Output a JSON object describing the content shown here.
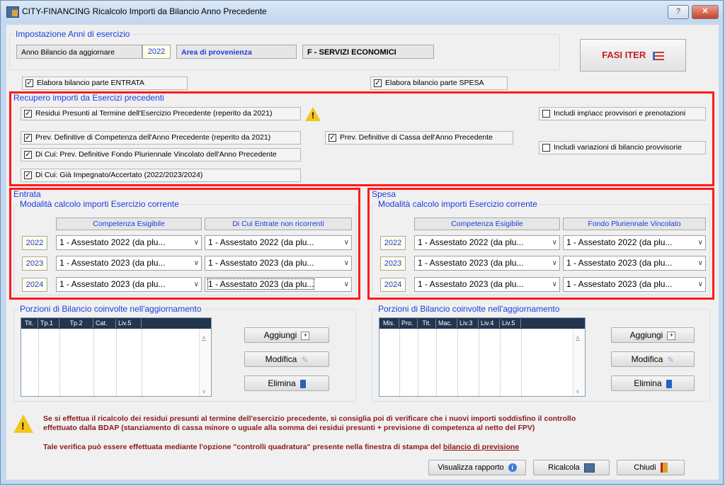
{
  "window": {
    "title": "CITY-FINANCING  Ricalcolo Importi da Bilancio Anno Precedente",
    "help_label": "?",
    "close_label": "✕"
  },
  "anni": {
    "legend": "Impostazione Anni di esercizio",
    "anno_label": "Anno Bilancio da aggiornare",
    "anno_value": "2022",
    "area_label": "Area di provenienza",
    "area_value": "F - SERVIZI ECONOMICI"
  },
  "fasi_iter_label": "FASI ITER",
  "elabora": {
    "entrata": "Elabora bilancio parte ENTRATA",
    "spesa": "Elabora bilancio parte SPESA"
  },
  "recupero": {
    "legend": "Recupero importi da Esercizi precedenti",
    "residui": "Residui Presunti al Termine dell'Esercizio Precedente (reperito da 2021)",
    "prev_comp": "Prev. Definitive di Competenza dell'Anno Precedente (reperito da 2021)",
    "prev_cassa": "Prev. Definitive di Cassa dell'Anno Precedente",
    "fondo": "Di Cui: Prev. Definitive Fondo Pluriennale Vincolato dell'Anno Precedente",
    "impegnato": "Di Cui: Già Impegnato/Accertato (2022/2023/2024)",
    "includi_imp": "Includi imp\\acc provvisori e prenotazioni",
    "includi_var": "Includi variazioni di bilancio provvisorie"
  },
  "entrata": {
    "legend": "Entrata",
    "sublegend": "Modalità calcolo importi Esercizio corrente",
    "col1": "Competenza Esigibile",
    "col2": "Di Cui Entrate non ricorrenti",
    "rows": [
      {
        "year": "2022",
        "c1": "1 - Assestato  2022 (da plu...",
        "c2": "1 - Assestato  2022 (da plu..."
      },
      {
        "year": "2023",
        "c1": "1 - Assestato  2023 (da plu...",
        "c2": "1 - Assestato  2023 (da plu..."
      },
      {
        "year": "2024",
        "c1": "1 - Assestato  2023 (da plu...",
        "c2": "1 - Assestato  2023 (da plu..."
      }
    ]
  },
  "spesa": {
    "legend": "Spesa",
    "sublegend": "Modalità calcolo importi Esercizio corrente",
    "col1": "Competenza Esigibile",
    "col2": "Fondo Pluriennale Vincolato",
    "rows": [
      {
        "year": "2022",
        "c1": "1 - Assestato  2022 (da plu...",
        "c2": "1 - Assestato  2022 (da plu..."
      },
      {
        "year": "2023",
        "c1": "1 - Assestato  2023 (da plu...",
        "c2": "1 - Assestato  2023 (da plu..."
      },
      {
        "year": "2024",
        "c1": "1 - Assestato  2023 (da plu...",
        "c2": "1 - Assestato  2023 (da plu..."
      }
    ]
  },
  "porzioni_entrata": {
    "legend": "Porzioni di Bilancio coinvolte nell'aggiornamento",
    "cols": [
      "Tit.",
      "Tp.1",
      "Tp.2",
      "Cat.",
      "Liv.5"
    ],
    "aggiungi": "Aggiungi",
    "modifica": "Modifica",
    "elimina": "Elimina"
  },
  "porzioni_spesa": {
    "legend": "Porzioni di Bilancio coinvolte nell'aggiornamento",
    "cols": [
      "Mis.",
      "Pro.",
      "Tit.",
      "Mac.",
      "Liv.3",
      "Liv.4",
      "Liv.5"
    ],
    "aggiungi": "Aggiungi",
    "modifica": "Modifica",
    "elimina": "Elimina"
  },
  "messages": {
    "line1": "Se si effettua il ricalcolo dei residui presunti al termine dell'esercizio precedente, si consiglia poi di verificare che i nuovi importi soddisfino il controllo",
    "line2": "effettuato dalla BDAP (stanziamento di cassa minore o uguale alla somma dei residui presunti + previsione di competenza al netto del FPV)",
    "line3_pre": "Tale verifica può essere effettuata mediante l'opzione \"controlli quadratura\" presente nella finestra di stampa del ",
    "line3_link": "bilancio di previsione"
  },
  "footer": {
    "visualizza": "Visualizza rapporto",
    "ricalcola": "Ricalcola",
    "chiudi": "Chiudi"
  },
  "colors": {
    "accent_blue": "#1c3cdc",
    "highlight_red": "#ff1a1a",
    "message_red": "#8b1a1a"
  }
}
